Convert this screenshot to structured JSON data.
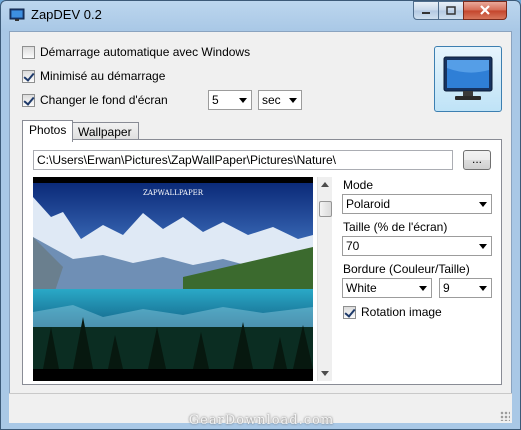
{
  "window": {
    "title": "ZapDEV 0.2",
    "controls": {
      "minimize": "minimize",
      "maximize": "maximize",
      "close": "close"
    }
  },
  "options": {
    "autostart_label": "Démarrage automatique avec Windows",
    "autostart_checked": false,
    "minimized_label": "Minimisé au démarrage",
    "minimized_checked": true,
    "change_wallpaper_label": "Changer le fond d'écran",
    "change_wallpaper_checked": true,
    "interval_value": "5",
    "interval_unit": "sec"
  },
  "tabs": [
    {
      "label": "Photos",
      "active": true
    },
    {
      "label": "Wallpaper",
      "active": false
    }
  ],
  "photos": {
    "path": "C:\\Users\\Erwan\\Pictures\\ZapWallPaper\\Pictures\\Nature\\",
    "browse_label": "...",
    "preview_caption": "ZAPWALLPAPER"
  },
  "settings": {
    "mode_label": "Mode",
    "mode_value": "Polaroid",
    "size_label": "Taille (% de l'écran)",
    "size_value": "70",
    "border_label": "Bordure (Couleur/Taille)",
    "border_color_value": "White",
    "border_size_value": "9",
    "rotation_label": "Rotation image",
    "rotation_checked": true
  },
  "watermark": "GearDownload.com",
  "colors": {
    "accent": "#3c7fb1",
    "titlebar": "#a9c8e6"
  }
}
